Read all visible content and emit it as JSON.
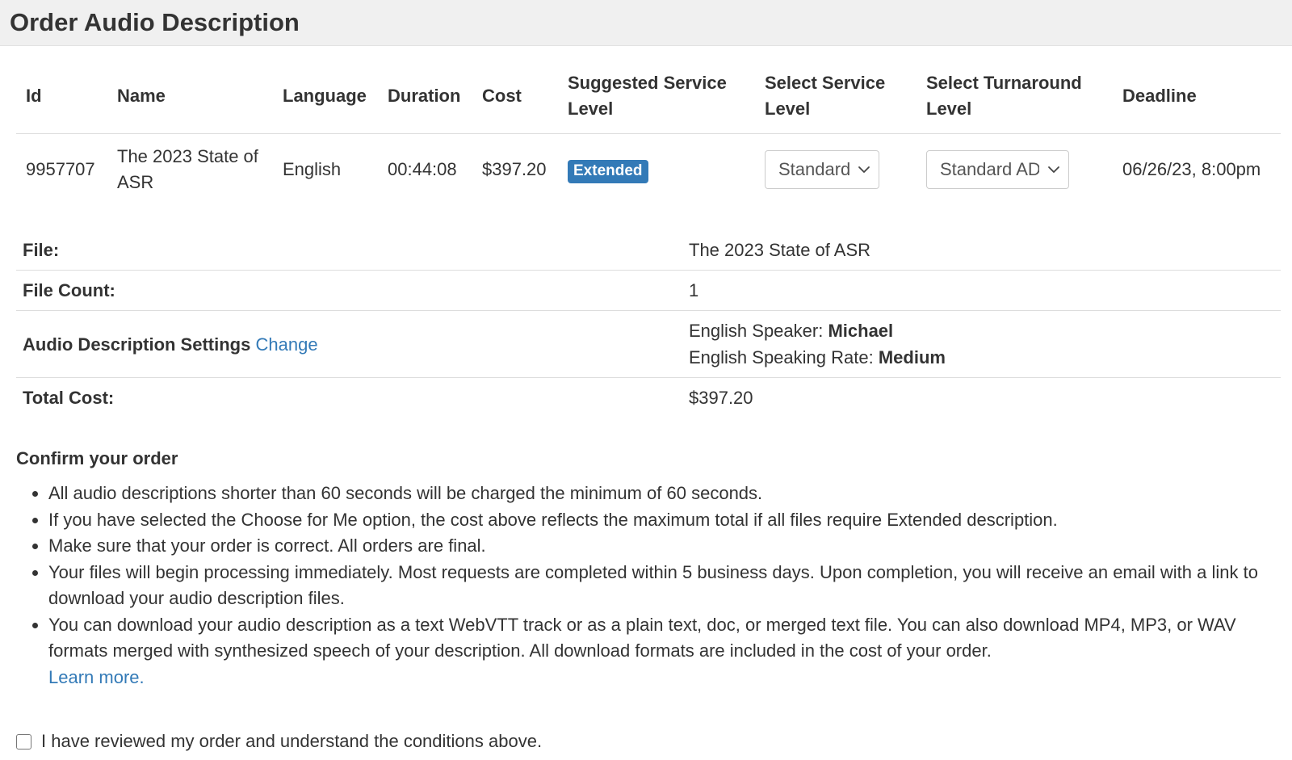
{
  "page": {
    "title": "Order Audio Description"
  },
  "table": {
    "headers": {
      "id": "Id",
      "name": "Name",
      "language": "Language",
      "duration": "Duration",
      "cost": "Cost",
      "suggested": "Suggested Service Level",
      "select_service": "Select Service Level",
      "select_turnaround": "Select Turnaround Level",
      "deadline": "Deadline"
    },
    "row": {
      "id": "9957707",
      "name": "The 2023 State of ASR",
      "language": "English",
      "duration": "00:44:08",
      "cost": "$397.20",
      "suggested_badge": "Extended",
      "service_select": "Standard",
      "turnaround_select": "Standard AD",
      "deadline": "06/26/23, 8:00pm"
    }
  },
  "details": {
    "file_label": "File:",
    "file_value": "The 2023 State of ASR",
    "count_label": "File Count:",
    "count_value": "1",
    "settings_label": "Audio Description Settings",
    "settings_change": "Change",
    "speaker_label": "English Speaker:",
    "speaker_value": "Michael",
    "rate_label": "English Speaking Rate:",
    "rate_value": "Medium",
    "total_label": "Total Cost:",
    "total_value": "$397.20"
  },
  "confirm": {
    "title": "Confirm your order",
    "items": [
      "All audio descriptions shorter than 60 seconds will be charged the minimum of 60 seconds.",
      "If you have selected the Choose for Me option, the cost above reflects the maximum total if all files require Extended description.",
      "Make sure that your order is correct. All orders are final.",
      "Your files will begin processing immediately. Most requests are completed within 5 business days. Upon completion, you will receive an email with a link to download your audio description files.",
      "You can download your audio description as a text WebVTT track or as a plain text, doc, or merged text file. You can also download MP4, MP3, or WAV formats merged with synthesized speech of your description. All download formats are included in the cost of your order."
    ],
    "learn_more": "Learn more.",
    "agree_text": "I have reviewed my order and understand the conditions above."
  },
  "colors": {
    "link": "#337ab7",
    "badge": "#337ab7",
    "header_bg": "#f0f0f0"
  },
  "icons": {
    "select_arrow": "chevron-down-icon"
  }
}
